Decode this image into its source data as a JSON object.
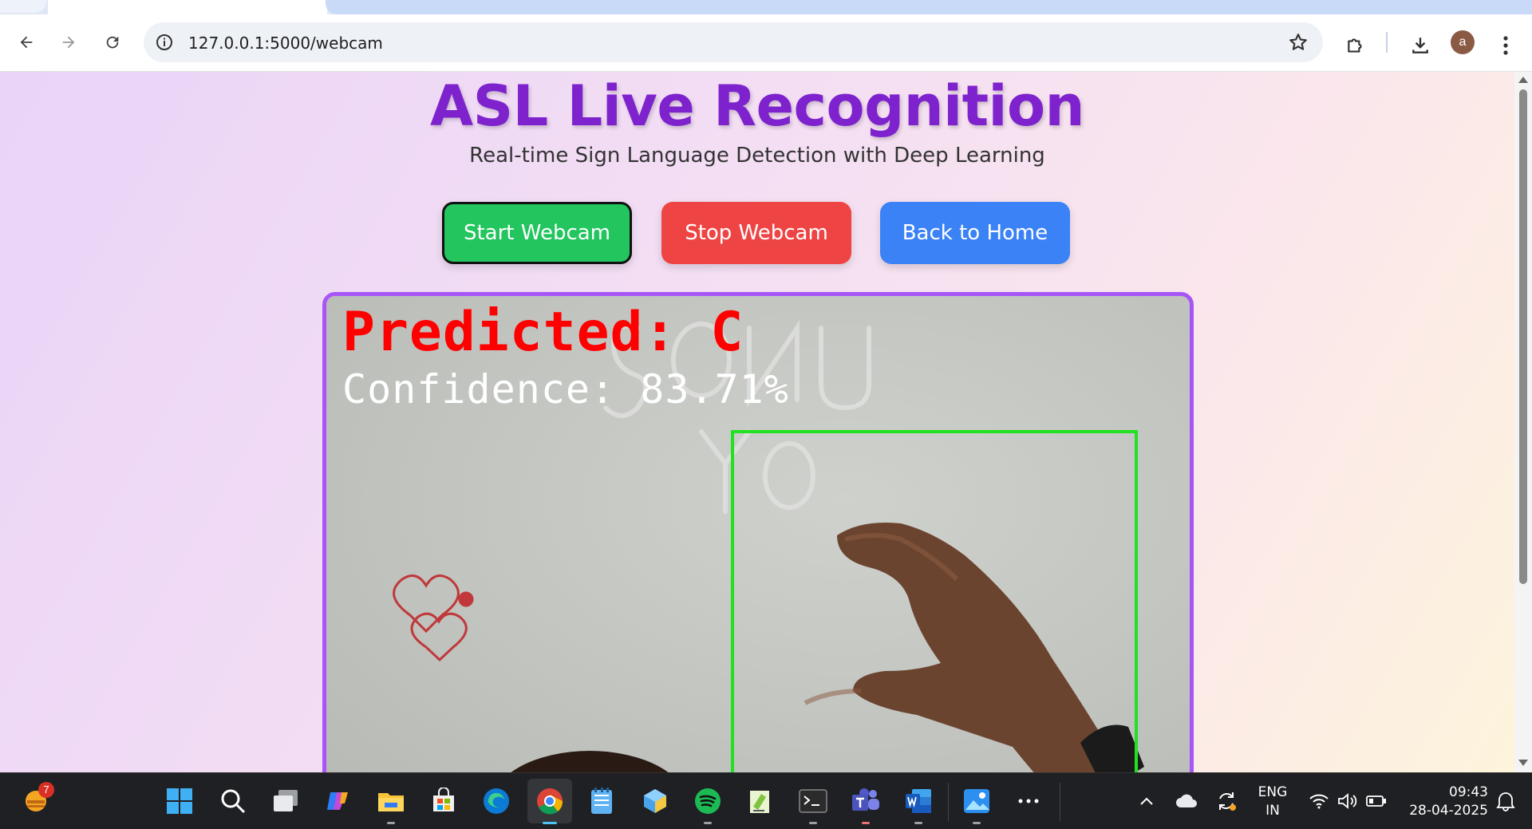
{
  "browser": {
    "url": "127.0.0.1:5000/webcam",
    "profile_initial": "a"
  },
  "page": {
    "title": "ASL Live Recognition",
    "subtitle": "Real-time Sign Language Detection with Deep Learning",
    "buttons": {
      "start": "Start Webcam",
      "stop": "Stop Webcam",
      "home": "Back to Home"
    },
    "video": {
      "prediction_text": "Predicted: C",
      "confidence_text": "Confidence: 83.71%"
    },
    "colors": {
      "title": "#7e22ce",
      "start": "#22c55e",
      "stop": "#ef4444",
      "home": "#3b82f6",
      "frame_border": "#a855f7",
      "prediction": "#ff0000",
      "bbox": "#22e022"
    }
  },
  "taskbar": {
    "notification_count": "7",
    "language_line1": "ENG",
    "language_line2": "IN",
    "time": "09:43",
    "date": "28-04-2025",
    "apps": [
      "weather-widget",
      "start",
      "search",
      "task-view",
      "copilot",
      "file-explorer",
      "microsoft-store",
      "edge",
      "chrome",
      "notepad",
      "3d-viewer",
      "spotify",
      "notepad-plus-plus",
      "terminal",
      "teams",
      "word",
      "photos",
      "more"
    ]
  }
}
